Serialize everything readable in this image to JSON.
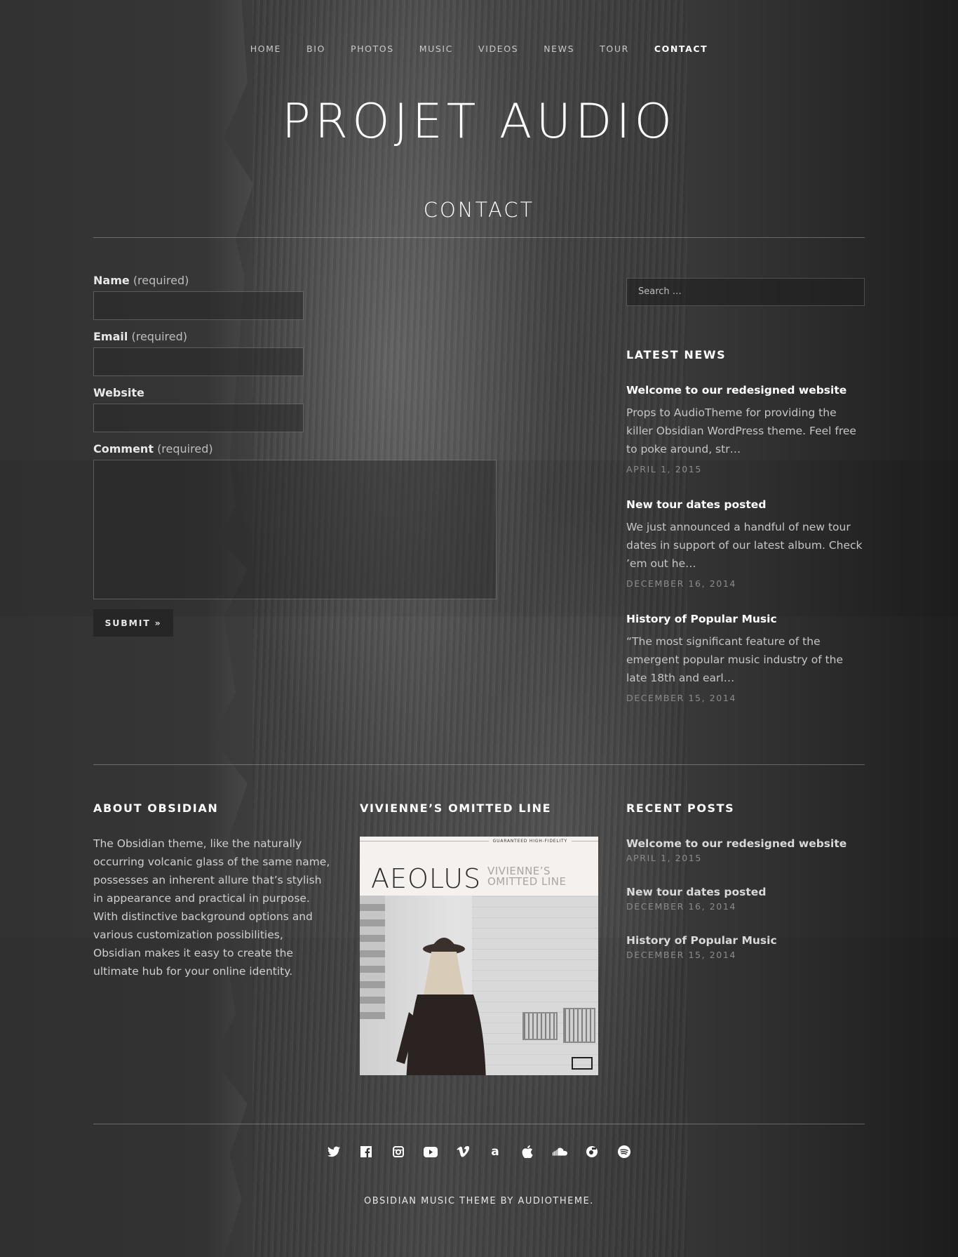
{
  "nav": [
    {
      "label": "HOME",
      "active": false
    },
    {
      "label": "BIO",
      "active": false
    },
    {
      "label": "PHOTOS",
      "active": false
    },
    {
      "label": "MUSIC",
      "active": false
    },
    {
      "label": "VIDEOS",
      "active": false
    },
    {
      "label": "NEWS",
      "active": false
    },
    {
      "label": "TOUR",
      "active": false
    },
    {
      "label": "CONTACT",
      "active": true
    }
  ],
  "site_title": "PROJET AUDIO",
  "page_title": "CONTACT",
  "form": {
    "name_label": "Name",
    "name_required": "(required)",
    "email_label": "Email",
    "email_required": "(required)",
    "website_label": "Website",
    "comment_label": "Comment",
    "comment_required": "(required)",
    "submit_label": "SUBMIT »"
  },
  "sidebar": {
    "search_placeholder": "Search …",
    "latest_news_title": "LATEST NEWS",
    "news": [
      {
        "title": "Welcome to our redesigned website",
        "excerpt": "Props to AudioTheme for providing the killer Obsidian WordPress theme. Feel free to poke around, str…",
        "date": "APRIL 1, 2015"
      },
      {
        "title": "New tour dates posted",
        "excerpt": "We just announced a handful of new tour dates in support of our latest album. Check ’em out he…",
        "date": "DECEMBER 16, 2014"
      },
      {
        "title": "History of Popular Music",
        "excerpt": "“The most significant feature of the emergent popular music industry of the late 18th and earl…",
        "date": "DECEMBER 15, 2014"
      }
    ]
  },
  "footer": {
    "about_title": "ABOUT OBSIDIAN",
    "about_text": "The Obsidian theme, like the naturally occurring volcanic glass of the same name, possesses an inherent allure that’s stylish in appearance and practical in purpose. With distinctive background options and various customization possibilities, Obsidian makes it easy to create the ultimate hub for your online identity.",
    "album_widget_title": "VIVIENNE’S OMITTED LINE",
    "album_cover": {
      "banner": "GUARANTEED HIGH-FIDELITY",
      "title": "AEOLUS",
      "subtitle_1": "VIVIENNE’S",
      "subtitle_2": "OMITTED LINE"
    },
    "recent_posts_title": "RECENT POSTS",
    "recent_posts": [
      {
        "title": "Welcome to our redesigned website",
        "date": "APRIL 1, 2015"
      },
      {
        "title": "New tour dates posted",
        "date": "DECEMBER 16, 2014"
      },
      {
        "title": "History of Popular Music",
        "date": "DECEMBER 15, 2014"
      }
    ],
    "social_icons": [
      "twitter-icon",
      "facebook-icon",
      "instagram-icon",
      "youtube-icon",
      "vimeo-icon",
      "amazon-icon",
      "apple-icon",
      "soundcloud-icon",
      "bandcamp-icon",
      "spotify-icon"
    ],
    "credit": "OBSIDIAN MUSIC THEME BY AUDIOTHEME."
  }
}
